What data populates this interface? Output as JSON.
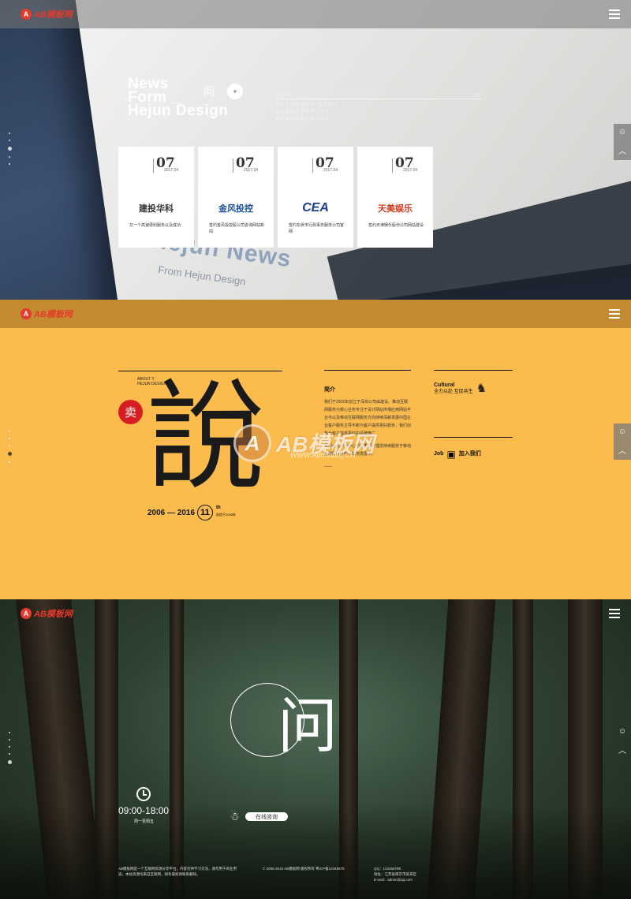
{
  "brand": {
    "logo_mark": "A",
    "logo_text": "AB模板网"
  },
  "section1": {
    "news_title": [
      "News",
      "Form",
      "Hejun Design"
    ],
    "news_title_mini": "NEWS",
    "question_char": "问",
    "more_button": "+",
    "list_header_left": "合骏新闻",
    "list_header_right": "更多",
    "list_items": [
      "◆ 小 心 以 优 势 品 牌 · 设 计 成 长",
      "◆ 上 善 若 水 公 司 举 行 年 会",
      "◆ 合 骏 设 计 新 闻 发 布 活 动"
    ],
    "paper_text": "Hejun News",
    "paper_sub": "From Hejun Design",
    "cards": [
      {
        "day": "07",
        "ym": "2017.04",
        "logo": "建投华科",
        "logo_color": "#333333",
        "desc": "又一个高速便利服务以及成功"
      },
      {
        "day": "07",
        "ym": "2017.04",
        "logo": "金风投控",
        "logo_color": "#1d4f9c",
        "desc": "签约金风投控股公司咨询网站新闻"
      },
      {
        "day": "07",
        "ym": "2017.04",
        "logo": "CEA",
        "logo_color": "#1e3f8f",
        "desc": "签约东侨市行政事务服务公司官网"
      },
      {
        "day": "07",
        "ym": "2017.04",
        "logo": "天美娱乐",
        "logo_color": "#d23a1e",
        "desc": "签约天津娱乐股份公司网站建设"
      }
    ]
  },
  "section2": {
    "about_label": [
      "ABOUT Y",
      "HEJUN DESIGN"
    ],
    "seal_char": "卖",
    "big_char": "說",
    "years_text": "2006 — 2016",
    "years_num": "11",
    "years_th": "th",
    "years_note": "创造于2006年",
    "intro_title": "简介",
    "intro_paragraphs": [
      "我们于2006年创立于深圳公司由建设、推动互联网服务为核心业务专注于设计网站传播应用网站平台与以及移动互联网服务方向持续深耕发展中国企业客户服务主导不断为客户提供更好服务，我们创新为客户提供更好的品牌推广",
      "我们以用户为中心的优质设计理念持续服务于移动互联网行业中不断地发展中。",
      "——"
    ],
    "cultural_title": "Cultural",
    "cultural_sub": "全力以赴 互促共生",
    "job_title": "Job",
    "job_sub": "加入我们",
    "watermark_main": "AB模板网",
    "watermark_sub": "WWW.Adminbuy.CN"
  },
  "section3": {
    "question_char": "问",
    "hours": "09:00-18:00",
    "days": "周一至周五",
    "consult_label": "在线咨询",
    "footer_left": "AB模板网是一个互联网资源分享平台，内容仅供学习交流，请勿用于商业用途。本站资源均来自互联网，如有侵权请联系删除。",
    "footer_mid": "© 2006-2016 AB模板网 版权所有  粤ICP备12345678",
    "footer_right": "QQ：123456789\n地址：江苏省南京市某某区\nE-mail：admin@qq.com"
  }
}
